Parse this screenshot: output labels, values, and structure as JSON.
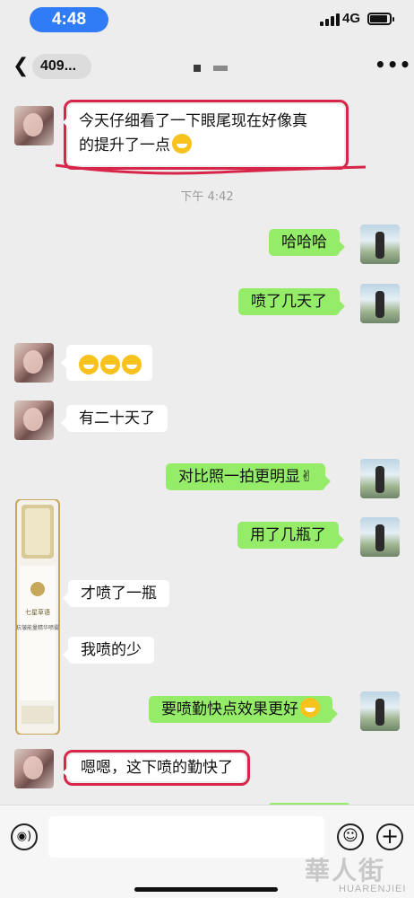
{
  "status_bar": {
    "time": "4:48",
    "network": "4G"
  },
  "header": {
    "back_icon": "chevron-left",
    "title": "409...",
    "more_icon": "ellipsis"
  },
  "timestamp": "下午 4:42",
  "messages": [
    {
      "side": "left",
      "line1": "今天仔细看了一下眼尾现在好像真",
      "line2": "的提升了一点"
    },
    {
      "side": "right",
      "text": "哈哈哈"
    },
    {
      "side": "right",
      "text": "喷了几天了"
    },
    {
      "side": "left",
      "emoji_count": 3
    },
    {
      "side": "left",
      "text": "有二十天了"
    },
    {
      "side": "right",
      "text": "对比照一拍更明显✌"
    },
    {
      "side": "right",
      "text": "用了几瓶了"
    },
    {
      "side": "left",
      "text": "才喷了一瓶"
    },
    {
      "side": "left",
      "text": "我喷的少"
    },
    {
      "side": "right",
      "text": "要喷勤快点效果更好"
    },
    {
      "side": "left",
      "text": "嗯嗯，这下喷的勤快了"
    }
  ],
  "product": {
    "label_top": "七星草语",
    "label_body": "抗皱能量精华喷雾"
  },
  "input_bar": {
    "voice_icon": "voice",
    "emoji_icon": "smile",
    "add_icon": "plus"
  },
  "watermark": {
    "cn": "華人街",
    "en": "HUARENJIEI"
  },
  "colors": {
    "outgoing": "#95ec69",
    "incoming": "#ffffff",
    "highlight": "#d7264a",
    "time_pill": "#2f7cf6"
  }
}
